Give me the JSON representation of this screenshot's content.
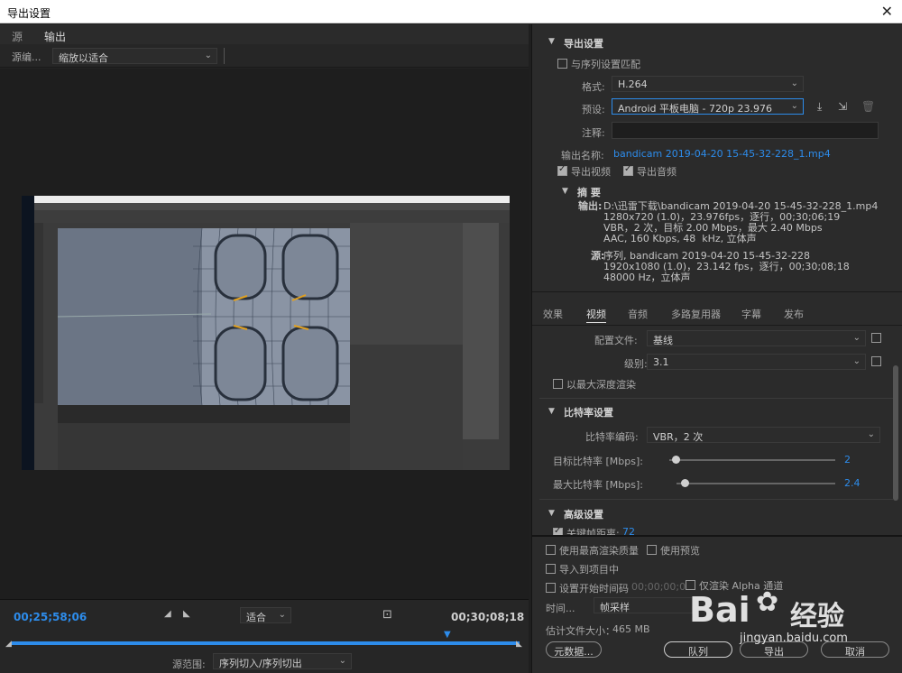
{
  "window": {
    "title": "导出设置",
    "close_glyph": "✕"
  },
  "left": {
    "tabs": [
      {
        "label": "源"
      },
      {
        "label": "输出"
      }
    ],
    "source_label": "源编...",
    "source_scale": "缩放以适合",
    "timecode_in": "00;25;58;06",
    "timecode_out": "00;30;08;18",
    "fit": "适合",
    "source_range_label": "源范围:",
    "source_range": "序列切入/序列切出"
  },
  "export_settings": {
    "title": "导出设置",
    "match_sequence": "与序列设置匹配",
    "format_label": "格式:",
    "format": "H.264",
    "preset_label": "预设:",
    "preset": "Android 平板电脑 - 720p 23.976",
    "comment_label": "注释:",
    "output_name_label": "输出名称:",
    "output_name": "bandicam 2019-04-20 15-45-32-228_1.mp4",
    "export_video": "导出视频",
    "export_audio": "导出音频",
    "summary_title": "摘 要",
    "output_label": "输出:",
    "output_lines": "D:\\迅雷下载\\bandicam 2019-04-20 15-45-32-228_1.mp4\n1280x720 (1.0)，23.976fps，逐行，00;30;06;19\nVBR，2 次，目标 2.00 Mbps，最大 2.40 Mbps\nAAC, 160 Kbps, 48  kHz, 立体声",
    "source_label": "源:",
    "source_lines": "序列, bandicam 2019-04-20 15-45-32-228\n1920x1080 (1.0)，23.142 fps，逐行，00;30;08;18\n48000 Hz，立体声"
  },
  "tabs2": [
    {
      "label": "效果"
    },
    {
      "label": "视频"
    },
    {
      "label": "音频"
    },
    {
      "label": "多路复用器"
    },
    {
      "label": "字幕"
    },
    {
      "label": "发布"
    }
  ],
  "video": {
    "profile_label": "配置文件:",
    "profile": "基线",
    "level_label": "级别:",
    "level": "3.1",
    "max_depth": "以最大深度渲染",
    "bitrate_title": "比特率设置",
    "encoding_label": "比特率编码:",
    "encoding": "VBR，2 次",
    "target_label": "目标比特率 [Mbps]:",
    "target_value": "2",
    "target_fraction": 0.04,
    "max_label": "最大比特率 [Mbps]:",
    "max_value": "2.4",
    "max_fraction": 0.05,
    "advanced_title": "高级设置",
    "keyframe": "关键帧距离:",
    "keyframe_value": "72"
  },
  "bottom": {
    "max_render_quality": "使用最高渲染质量",
    "use_preview": "使用预览",
    "import_project": "导入到项目中",
    "set_start_tc": "设置开始时间码",
    "start_tc": "00;00;00;00",
    "render_alpha": "仅渲染 Alpha 通道",
    "time_interp_label": "时间...",
    "time_interp": "帧采样",
    "est_size_label": "估计文件大小：",
    "est_size": "465 MB",
    "metadata_btn": "元数据...",
    "queue_btn": "队列",
    "export_btn": "导出",
    "cancel_btn": "取消"
  },
  "watermark": {
    "brand": "Bai",
    "brand2": "经验",
    "url": "jingyan.baidu.com"
  }
}
